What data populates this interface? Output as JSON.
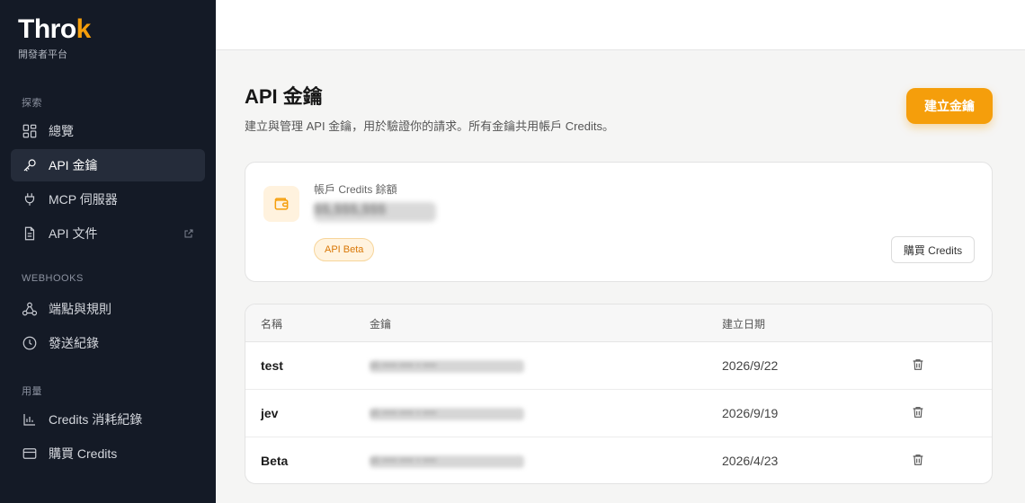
{
  "brand": {
    "name_main": "Throk",
    "name_accent": "k",
    "subtitle": "開發者平台",
    "accent_color": "#f59e0b"
  },
  "sidebar": {
    "sections": [
      {
        "label": "探索",
        "items": [
          {
            "label": "總覽",
            "icon": "grid-icon",
            "active": false
          },
          {
            "label": "API 金鑰",
            "icon": "key-icon",
            "active": true
          },
          {
            "label": "MCP 伺服器",
            "icon": "plug-icon",
            "active": false
          },
          {
            "label": "API 文件",
            "icon": "document-icon",
            "active": false,
            "external": true
          }
        ]
      },
      {
        "label": "WEBHOOKS",
        "items": [
          {
            "label": "端點與規則",
            "icon": "webhook-icon",
            "active": false
          },
          {
            "label": "發送紀錄",
            "icon": "clock-icon",
            "active": false
          }
        ]
      },
      {
        "label": "用量",
        "items": [
          {
            "label": "Credits 消耗紀錄",
            "icon": "bar-chart-icon",
            "active": false
          },
          {
            "label": "購買 Credits",
            "icon": "credit-card-icon",
            "active": false
          }
        ]
      }
    ]
  },
  "main": {
    "title": "API 金鑰",
    "description": "建立與管理 API 金鑰，用於驗證你的請求。所有金鑰共用帳戶 Credits。",
    "create_button": "建立金鑰"
  },
  "credits": {
    "label": "帳戶 Credits 餘額",
    "balance": "$$,$$$,$$$",
    "badge": "API Beta",
    "buy_button": "購買 Credits"
  },
  "keys_table": {
    "headers": {
      "name": "名稱",
      "key": "金鑰",
      "created": "建立日期"
    },
    "rows": [
      {
        "name": "test",
        "key": "sk-••••-•••• • ••••",
        "created": "2026/9/22"
      },
      {
        "name": "jev",
        "key": "sk-••••-•••• • ••••",
        "created": "2026/9/19"
      },
      {
        "name": "Beta",
        "key": "sk-••••-•••• • ••••",
        "created": "2026/4/23"
      }
    ]
  }
}
